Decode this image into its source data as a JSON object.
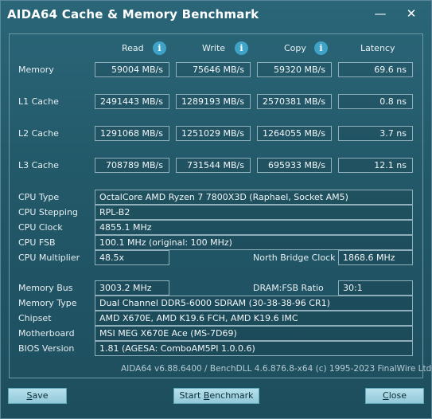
{
  "window": {
    "title": "AIDA64 Cache & Memory Benchmark",
    "minimize_glyph": "—",
    "close_glyph": "✕"
  },
  "columns": {
    "read": "Read",
    "write": "Write",
    "copy": "Copy",
    "latency": "Latency",
    "info_icon_glyph": "i"
  },
  "bench_rows": [
    {
      "label": "Memory",
      "read": "59004 MB/s",
      "write": "75646 MB/s",
      "copy": "59320 MB/s",
      "latency": "69.6 ns"
    },
    {
      "label": "L1 Cache",
      "read": "2491443 MB/s",
      "write": "1289193 MB/s",
      "copy": "2570381 MB/s",
      "latency": "0.8 ns"
    },
    {
      "label": "L2 Cache",
      "read": "1291068 MB/s",
      "write": "1251029 MB/s",
      "copy": "1264055 MB/s",
      "latency": "3.7 ns"
    },
    {
      "label": "L3 Cache",
      "read": "708789 MB/s",
      "write": "731544 MB/s",
      "copy": "695933 MB/s",
      "latency": "12.1 ns"
    }
  ],
  "cpu": {
    "type_label": "CPU Type",
    "type_value": "OctalCore AMD Ryzen 7 7800X3D  (Raphael, Socket AM5)",
    "stepping_label": "CPU Stepping",
    "stepping_value": "RPL-B2",
    "clock_label": "CPU Clock",
    "clock_value": "4855.1 MHz",
    "fsb_label": "CPU FSB",
    "fsb_value": "100.1 MHz  (original: 100 MHz)",
    "multiplier_label": "CPU Multiplier",
    "multiplier_value": "48.5x",
    "nb_clock_label": "North Bridge Clock",
    "nb_clock_value": "1868.6 MHz"
  },
  "memory": {
    "bus_label": "Memory Bus",
    "bus_value": "3003.2 MHz",
    "ratio_label": "DRAM:FSB Ratio",
    "ratio_value": "30:1",
    "type_label": "Memory Type",
    "type_value": "Dual Channel DDR5-6000 SDRAM  (30-38-38-96 CR1)",
    "chipset_label": "Chipset",
    "chipset_value": "AMD X670E, AMD K19.6 FCH, AMD K19.6 IMC",
    "motherboard_label": "Motherboard",
    "motherboard_value": "MSI MEG X670E Ace (MS-7D69)",
    "bios_label": "BIOS Version",
    "bios_value": "1.81  (AGESA: ComboAM5PI 1.0.0.6)"
  },
  "footer": {
    "version": "AIDA64 v6.88.6400 / BenchDLL 4.6.876.8-x64  (c) 1995-2023 FinalWire Ltd."
  },
  "buttons": {
    "save_first": "S",
    "save_rest": "ave",
    "start_pre": "Start ",
    "start_underlined": "B",
    "start_rest": "enchmark",
    "close_first": "C",
    "close_rest": "lose"
  },
  "colors": {
    "background": "#225868",
    "info_icon": "#3fa3c8",
    "button": "#a6d6e4"
  }
}
